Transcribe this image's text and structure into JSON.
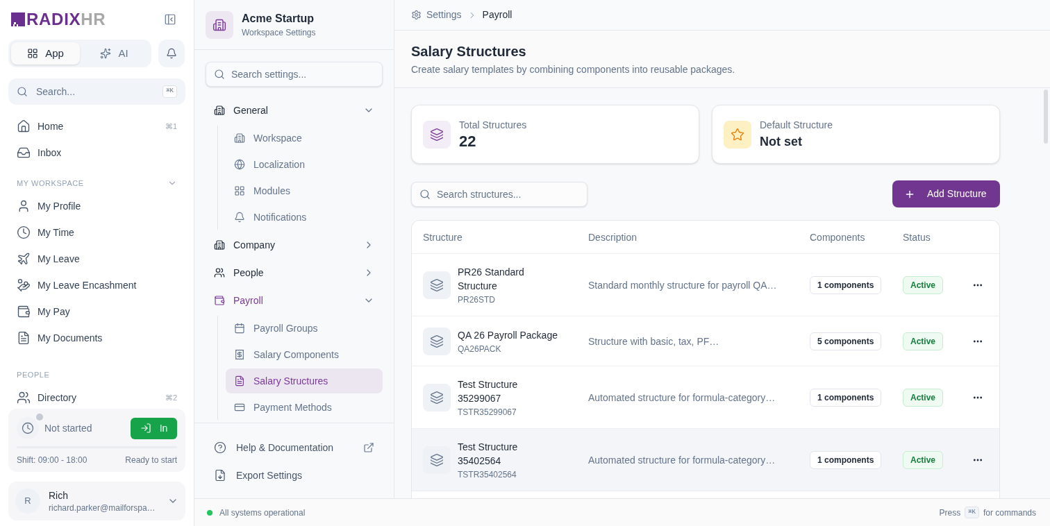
{
  "app_sidebar": {
    "logo": {
      "brand": "RADIX",
      "suffix": "HR"
    },
    "mode_tabs": [
      {
        "label": "App",
        "selected": true
      },
      {
        "label": "AI",
        "selected": false
      }
    ],
    "search": {
      "placeholder": "Search...",
      "shortcut": "⌘K"
    },
    "sections": [
      {
        "items": [
          {
            "label": "Home",
            "shortcut": "⌘1",
            "selected": false
          },
          {
            "label": "Inbox",
            "selected": false
          }
        ]
      },
      {
        "title": "MY WORKSPACE",
        "expanded": true,
        "items": [
          {
            "label": "My Profile",
            "selected": false
          },
          {
            "label": "My Time",
            "selected": false
          },
          {
            "label": "My Leave",
            "selected": false
          },
          {
            "label": "My Leave Encashment",
            "selected": false
          },
          {
            "label": "My Pay",
            "selected": false
          },
          {
            "label": "My Documents",
            "selected": false
          }
        ]
      },
      {
        "title": "PEOPLE",
        "items": [
          {
            "label": "Directory",
            "shortcut": "⌘2",
            "selected": false
          }
        ]
      }
    ],
    "time_clock": {
      "status": "Not started",
      "button": "In",
      "shift": "Shift: 09:00 - 18:00",
      "note": "Ready to start"
    },
    "user": {
      "initial": "R",
      "name": "Rich",
      "email": "richard.parker@mailforspa…"
    }
  },
  "settings_sidebar": {
    "workspace": {
      "name": "Acme Startup",
      "subtitle": "Workspace Settings"
    },
    "search": {
      "placeholder": "Search settings..."
    },
    "groups": [
      {
        "label": "General",
        "expanded": true,
        "selected": false,
        "children": [
          {
            "label": "Workspace",
            "selected": false
          },
          {
            "label": "Localization",
            "selected": false
          },
          {
            "label": "Modules",
            "selected": false
          },
          {
            "label": "Notifications",
            "selected": false
          }
        ]
      },
      {
        "label": "Company",
        "expanded": false,
        "selected": false
      },
      {
        "label": "People",
        "expanded": false,
        "selected": false
      },
      {
        "label": "Payroll",
        "expanded": true,
        "selected": true,
        "children": [
          {
            "label": "Payroll Groups",
            "selected": false
          },
          {
            "label": "Salary Components",
            "selected": false
          },
          {
            "label": "Salary Structures",
            "selected": true
          },
          {
            "label": "Payment Methods",
            "selected": false
          }
        ]
      }
    ],
    "footer_links": [
      {
        "label": "Help & Documentation",
        "external": true
      },
      {
        "label": "Export Settings",
        "external": false
      }
    ]
  },
  "breadcrumb": [
    {
      "label": "Settings",
      "current": false
    },
    {
      "label": "Payroll",
      "current": true
    }
  ],
  "page_header": {
    "title": "Salary Structures",
    "description": "Create salary templates by combining components into reusable packages."
  },
  "stats": [
    {
      "kind": "count",
      "label": "Total Structures",
      "value": "22"
    },
    {
      "kind": "default",
      "label": "Default Structure",
      "value": "Not set"
    }
  ],
  "toolbar": {
    "search": {
      "placeholder": "Search structures..."
    },
    "add_button": "Add Structure"
  },
  "table": {
    "columns": [
      "Structure",
      "Description",
      "Components",
      "Status"
    ],
    "rows": [
      {
        "name": "PR26 Standard Structure",
        "code": "PR26STD",
        "description": "Standard monthly structure for payroll QA…",
        "components": "1 components",
        "status": "Active",
        "highlighted": false
      },
      {
        "name": "QA 26 Payroll Package",
        "code": "QA26PACK",
        "description": "Structure with basic, tax, PF…",
        "components": "5 components",
        "status": "Active",
        "highlighted": false
      },
      {
        "name": "Test Structure 35299067",
        "code": "TSTR35299067",
        "description": "Automated structure for formula-category…",
        "components": "1 components",
        "status": "Active",
        "highlighted": false
      },
      {
        "name": "Test Structure 35402564",
        "code": "TSTR35402564",
        "description": "Automated structure for formula-category…",
        "components": "1 components",
        "status": "Active",
        "highlighted": true
      }
    ]
  },
  "status_bar": {
    "status": "All systems operational",
    "hint_before": "Press",
    "shortcut": "⌘K",
    "hint_after": "for commands"
  }
}
